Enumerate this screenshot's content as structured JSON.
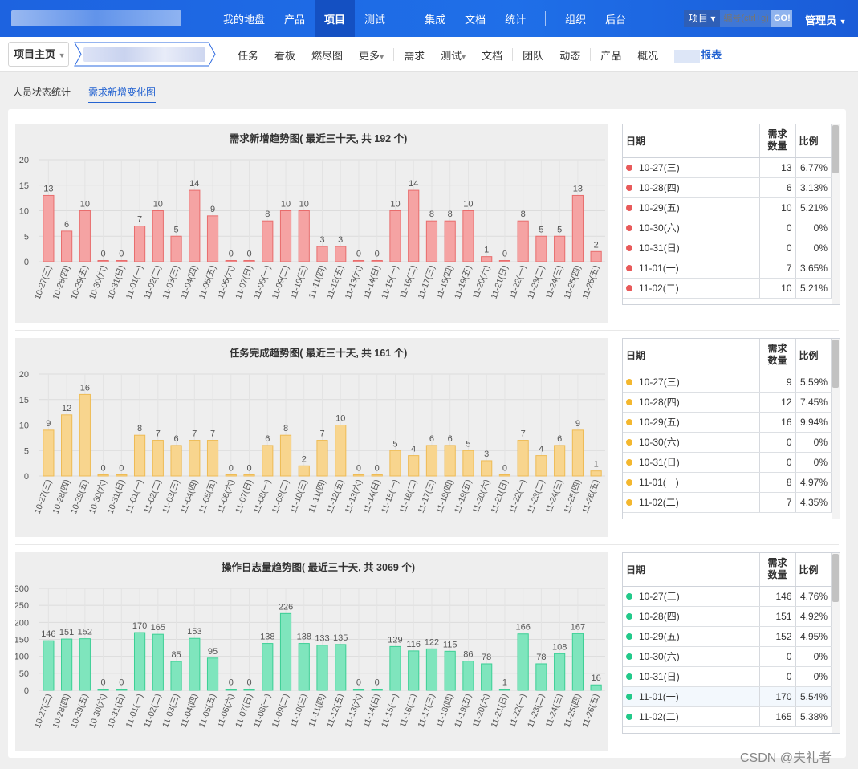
{
  "topbar": {
    "nav": [
      {
        "label": "我的地盘",
        "active": false
      },
      {
        "label": "产品",
        "active": false
      },
      {
        "label": "项目",
        "active": true
      },
      {
        "label": "测试",
        "active": false
      },
      {
        "label": "|",
        "sep": true
      },
      {
        "label": "集成",
        "active": false
      },
      {
        "label": "文档",
        "active": false
      },
      {
        "label": "统计",
        "active": false
      },
      {
        "label": "|",
        "sep": true
      },
      {
        "label": "组织",
        "active": false
      },
      {
        "label": "后台",
        "active": false
      }
    ],
    "search_type": "项目",
    "search_placeholder": "编号(ctrl+g)",
    "search_go": "GO!",
    "admin_label": "管理员"
  },
  "subbar": {
    "project_home": "项目主页",
    "items": [
      {
        "label": "任务"
      },
      {
        "label": "看板"
      },
      {
        "label": "燃尽图"
      },
      {
        "label": "更多",
        "caret": true
      },
      {
        "sep": true
      },
      {
        "label": "需求"
      },
      {
        "label": "测试",
        "caret": true
      },
      {
        "label": "文档"
      },
      {
        "sep": true
      },
      {
        "label": "团队"
      },
      {
        "label": "动态"
      },
      {
        "sep": true
      },
      {
        "label": "产品"
      },
      {
        "label": "概况"
      }
    ],
    "report_label": "报表"
  },
  "tabs": [
    {
      "label": "人员状态统计",
      "active": false
    },
    {
      "label": "需求新增变化图",
      "active": true
    }
  ],
  "table_headers": {
    "date": "日期",
    "count_line1": "需求",
    "count_line2": "数量",
    "ratio": "比例"
  },
  "watermark": "CSDN @夫礼者",
  "charts": [
    {
      "title": "需求新增趋势图( 最近三十天, 共 192 个)",
      "color": "#f5a3a3",
      "stroke": "#e86d6d",
      "dot_color": "#e85a5a",
      "chart_data": {
        "type": "bar",
        "title": "需求新增趋势图( 最近三十天, 共 192 个)",
        "categories": [
          "10-27(三)",
          "10-28(四)",
          "10-29(五)",
          "10-30(六)",
          "10-31(日)",
          "11-01(一)",
          "11-02(二)",
          "11-03(三)",
          "11-04(四)",
          "11-05(五)",
          "11-06(六)",
          "11-07(日)",
          "11-08(一)",
          "11-09(二)",
          "11-10(三)",
          "11-11(四)",
          "11-12(五)",
          "11-13(六)",
          "11-14(日)",
          "11-15(一)",
          "11-16(二)",
          "11-17(三)",
          "11-18(四)",
          "11-19(五)",
          "11-20(六)",
          "11-21(日)",
          "11-22(一)",
          "11-23(二)",
          "11-24(三)",
          "11-25(四)",
          "11-26(五)"
        ],
        "values": [
          13,
          6,
          10,
          0,
          0,
          7,
          10,
          5,
          14,
          9,
          0,
          0,
          8,
          10,
          10,
          3,
          3,
          0,
          0,
          10,
          14,
          8,
          8,
          10,
          1,
          0,
          8,
          5,
          5,
          13,
          2
        ],
        "ylim": [
          0,
          20
        ],
        "yticks": [
          0,
          5,
          10,
          15,
          20
        ]
      },
      "rows": [
        {
          "date": "10-27(三)",
          "count": "13",
          "ratio": "6.77%"
        },
        {
          "date": "10-28(四)",
          "count": "6",
          "ratio": "3.13%"
        },
        {
          "date": "10-29(五)",
          "count": "10",
          "ratio": "5.21%"
        },
        {
          "date": "10-30(六)",
          "count": "0",
          "ratio": "0%"
        },
        {
          "date": "10-31(日)",
          "count": "0",
          "ratio": "0%"
        },
        {
          "date": "11-01(一)",
          "count": "7",
          "ratio": "3.65%"
        },
        {
          "date": "11-02(二)",
          "count": "10",
          "ratio": "5.21%"
        }
      ]
    },
    {
      "title": "任务完成趋势图( 最近三十天, 共 161 个)",
      "color": "#f8d58e",
      "stroke": "#eebb55",
      "dot_color": "#f4b72e",
      "chart_data": {
        "type": "bar",
        "title": "任务完成趋势图( 最近三十天, 共 161 个)",
        "categories": [
          "10-27(三)",
          "10-28(四)",
          "10-29(五)",
          "10-30(六)",
          "10-31(日)",
          "11-01(一)",
          "11-02(二)",
          "11-03(三)",
          "11-04(四)",
          "11-05(五)",
          "11-06(六)",
          "11-07(日)",
          "11-08(一)",
          "11-09(二)",
          "11-10(三)",
          "11-11(四)",
          "11-12(五)",
          "11-13(六)",
          "11-14(日)",
          "11-15(一)",
          "11-16(二)",
          "11-17(三)",
          "11-18(四)",
          "11-19(五)",
          "11-20(六)",
          "11-21(日)",
          "11-22(一)",
          "11-23(二)",
          "11-24(三)",
          "11-25(四)",
          "11-26(五)"
        ],
        "values": [
          9,
          12,
          16,
          0,
          0,
          8,
          7,
          6,
          7,
          7,
          0,
          0,
          6,
          8,
          2,
          7,
          10,
          0,
          0,
          5,
          4,
          6,
          6,
          5,
          3,
          0,
          7,
          4,
          6,
          9,
          1
        ],
        "ylim": [
          0,
          20
        ],
        "yticks": [
          0,
          5,
          10,
          15,
          20
        ]
      },
      "rows": [
        {
          "date": "10-27(三)",
          "count": "9",
          "ratio": "5.59%"
        },
        {
          "date": "10-28(四)",
          "count": "12",
          "ratio": "7.45%"
        },
        {
          "date": "10-29(五)",
          "count": "16",
          "ratio": "9.94%"
        },
        {
          "date": "10-30(六)",
          "count": "0",
          "ratio": "0%"
        },
        {
          "date": "10-31(日)",
          "count": "0",
          "ratio": "0%"
        },
        {
          "date": "11-01(一)",
          "count": "8",
          "ratio": "4.97%"
        },
        {
          "date": "11-02(二)",
          "count": "7",
          "ratio": "4.35%"
        }
      ]
    },
    {
      "title": "操作日志量趋势图( 最近三十天, 共 3069 个)",
      "color": "#7fe5bd",
      "stroke": "#3ccf95",
      "dot_color": "#22c98a",
      "chart_data": {
        "type": "bar",
        "title": "操作日志量趋势图( 最近三十天, 共 3069 个)",
        "categories": [
          "10-27(三)",
          "10-28(四)",
          "10-29(五)",
          "10-30(六)",
          "10-31(日)",
          "11-01(一)",
          "11-02(二)",
          "11-03(三)",
          "11-04(四)",
          "11-05(五)",
          "11-06(六)",
          "11-07(日)",
          "11-08(一)",
          "11-09(二)",
          "11-10(三)",
          "11-11(四)",
          "11-12(五)",
          "11-13(六)",
          "11-14(日)",
          "11-15(一)",
          "11-16(二)",
          "11-17(三)",
          "11-18(四)",
          "11-19(五)",
          "11-20(六)",
          "11-21(日)",
          "11-22(一)",
          "11-23(二)",
          "11-24(三)",
          "11-25(四)",
          "11-26(五)"
        ],
        "values": [
          146,
          151,
          152,
          0,
          0,
          170,
          165,
          85,
          153,
          95,
          0,
          0,
          138,
          226,
          138,
          133,
          135,
          0,
          0,
          129,
          116,
          122,
          115,
          86,
          78,
          1,
          166,
          78,
          108,
          167,
          16
        ],
        "ylim": [
          0,
          300
        ],
        "yticks": [
          0,
          50,
          100,
          150,
          200,
          250,
          300
        ]
      },
      "highlight_row": 5,
      "rows": [
        {
          "date": "10-27(三)",
          "count": "146",
          "ratio": "4.76%"
        },
        {
          "date": "10-28(四)",
          "count": "151",
          "ratio": "4.92%"
        },
        {
          "date": "10-29(五)",
          "count": "152",
          "ratio": "4.95%"
        },
        {
          "date": "10-30(六)",
          "count": "0",
          "ratio": "0%"
        },
        {
          "date": "10-31(日)",
          "count": "0",
          "ratio": "0%"
        },
        {
          "date": "11-01(一)",
          "count": "170",
          "ratio": "5.54%"
        },
        {
          "date": "11-02(二)",
          "count": "165",
          "ratio": "5.38%"
        }
      ]
    }
  ]
}
